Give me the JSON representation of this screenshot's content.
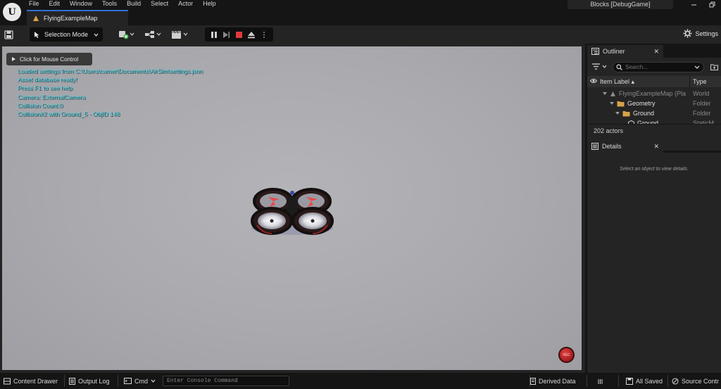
{
  "app": {
    "project_name": "Blocks [DebugGame]",
    "menu": [
      "File",
      "Edit",
      "Window",
      "Tools",
      "Build",
      "Select",
      "Actor",
      "Help"
    ],
    "level_tab": "FlyingExampleMap"
  },
  "toolbar": {
    "selection_mode": "Selection Mode",
    "settings_label": "Settings"
  },
  "viewport": {
    "mouse_control_label": "Click for Mouse Control",
    "log_lines": [
      "Loaded settings from C:\\Users\\camer\\Documents\\AirSim\\settings.json",
      "Asset database ready!",
      "Press F1 to see help",
      "Camera: ExternalCamera",
      "Collision Count:0",
      "Collision#2 with Ground_5 - ObjID 148"
    ],
    "log_color": "#3bd3e6",
    "rec_label": "REC"
  },
  "outliner": {
    "tab_label": "Outliner",
    "search_placeholder": "Search...",
    "col_label": "Item Label ▴",
    "col_type": "Type",
    "rows": [
      {
        "name": "FlyingExampleMap (Pla",
        "type": "World"
      },
      {
        "name": "Geometry",
        "type": "Folder"
      },
      {
        "name": "Ground",
        "type": "Folder"
      },
      {
        "name": "Ground",
        "type": "StaticM"
      }
    ],
    "actor_count": "202 actors"
  },
  "details": {
    "tab_label": "Details",
    "empty_message": "Select an object to view details."
  },
  "statusbar": {
    "content_drawer": "Content Drawer",
    "output_log": "Output Log",
    "cmd": "Cmd",
    "console_placeholder": "Enter Console Command",
    "derived_data": "Derived Data",
    "all_saved": "All Saved",
    "source_control": "Source Contr"
  },
  "colors": {
    "accent": "#2f6fd8",
    "folder": "#d6a24a",
    "stop": "#e03a3a"
  }
}
